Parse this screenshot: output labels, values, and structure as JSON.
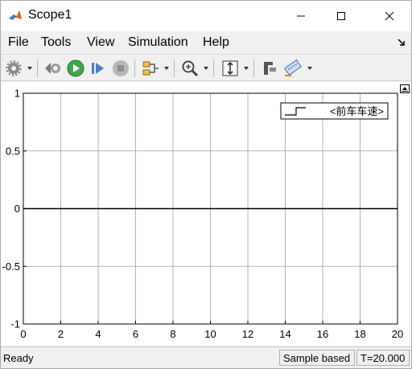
{
  "window": {
    "title": "Scope1"
  },
  "menu": {
    "items": [
      "File",
      "Tools",
      "View",
      "Simulation",
      "Help"
    ]
  },
  "toolbar": {
    "buttons": [
      "settings-gear-icon",
      "step-back-icon",
      "run-icon",
      "step-forward-icon",
      "stop-icon",
      "signal-selector-icon",
      "zoom-in-icon",
      "fit-to-view-icon",
      "highlight-block-icon",
      "measurements-icon"
    ]
  },
  "status": {
    "ready": "Ready",
    "sample_mode": "Sample based",
    "time": "T=20.000"
  },
  "chart_data": {
    "type": "line",
    "xlim": [
      0,
      20
    ],
    "ylim": [
      -1,
      1
    ],
    "x_ticks": [
      "0",
      "2",
      "4",
      "6",
      "8",
      "10",
      "12",
      "14",
      "16",
      "18",
      "20"
    ],
    "y_ticks": [
      "1",
      "0.5",
      "0",
      "-0.5",
      "-1"
    ],
    "grid": true,
    "legend_position": "top-right",
    "series": [
      {
        "name": "<前车车速>",
        "color": "#000000",
        "x": [
          0,
          20
        ],
        "y": [
          0,
          0
        ]
      }
    ]
  }
}
